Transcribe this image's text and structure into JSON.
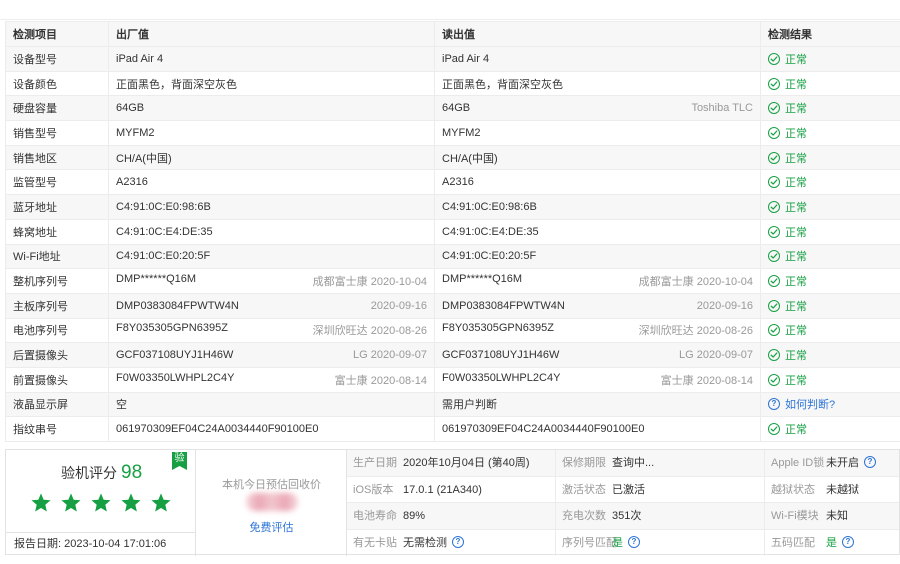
{
  "table": {
    "headers": [
      "检测项目",
      "出厂值",
      "读出值",
      "检测结果"
    ],
    "rows": [
      {
        "label": "设备型号",
        "factory": "iPad Air 4",
        "factory_note": "",
        "read": "iPad Air 4",
        "read_note": "",
        "result": "正常",
        "status": "ok"
      },
      {
        "label": "设备颜色",
        "factory": "正面黑色，背面深空灰色",
        "factory_note": "",
        "read": "正面黑色，背面深空灰色",
        "read_note": "",
        "result": "正常",
        "status": "ok"
      },
      {
        "label": "硬盘容量",
        "factory": "64GB",
        "factory_note": "",
        "read": "64GB",
        "read_note": "Toshiba TLC",
        "result": "正常",
        "status": "ok"
      },
      {
        "label": "销售型号",
        "factory": "MYFM2",
        "factory_note": "",
        "read": "MYFM2",
        "read_note": "",
        "result": "正常",
        "status": "ok"
      },
      {
        "label": "销售地区",
        "factory": "CH/A(中国)",
        "factory_note": "",
        "read": "CH/A(中国)",
        "read_note": "",
        "result": "正常",
        "status": "ok"
      },
      {
        "label": "监管型号",
        "factory": "A2316",
        "factory_note": "",
        "read": "A2316",
        "read_note": "",
        "result": "正常",
        "status": "ok"
      },
      {
        "label": "蓝牙地址",
        "factory": "C4:91:0C:E0:98:6B",
        "factory_note": "",
        "read": "C4:91:0C:E0:98:6B",
        "read_note": "",
        "result": "正常",
        "status": "ok"
      },
      {
        "label": "蜂窝地址",
        "factory": "C4:91:0C:E4:DE:35",
        "factory_note": "",
        "read": "C4:91:0C:E4:DE:35",
        "read_note": "",
        "result": "正常",
        "status": "ok"
      },
      {
        "label": "Wi-Fi地址",
        "factory": "C4:91:0C:E0:20:5F",
        "factory_note": "",
        "read": "C4:91:0C:E0:20:5F",
        "read_note": "",
        "result": "正常",
        "status": "ok"
      },
      {
        "label": "整机序列号",
        "factory": "DMP******Q16M",
        "factory_note": "成都富士康 2020-10-04",
        "read": "DMP******Q16M",
        "read_note": "成都富士康 2020-10-04",
        "result": "正常",
        "status": "ok"
      },
      {
        "label": "主板序列号",
        "factory": "DMP0383084FPWTW4N",
        "factory_note": "2020-09-16",
        "read": "DMP0383084FPWTW4N",
        "read_note": "2020-09-16",
        "result": "正常",
        "status": "ok"
      },
      {
        "label": "电池序列号",
        "factory": "F8Y035305GPN6395Z",
        "factory_note": "深圳欣旺达 2020-08-26",
        "read": "F8Y035305GPN6395Z",
        "read_note": "深圳欣旺达 2020-08-26",
        "result": "正常",
        "status": "ok"
      },
      {
        "label": "后置摄像头",
        "factory": "GCF037108UYJ1H46W",
        "factory_note": "LG 2020-09-07",
        "read": "GCF037108UYJ1H46W",
        "read_note": "LG 2020-09-07",
        "result": "正常",
        "status": "ok"
      },
      {
        "label": "前置摄像头",
        "factory": "F0W03350LWHPL2C4Y",
        "factory_note": "富士康 2020-08-14",
        "read": "F0W03350LWHPL2C4Y",
        "read_note": "富士康 2020-08-14",
        "result": "正常",
        "status": "ok"
      },
      {
        "label": "液晶显示屏",
        "factory": "空",
        "factory_note": "",
        "read": "需用户判断",
        "read_note": "",
        "result": "如何判断?",
        "status": "ask"
      },
      {
        "label": "指纹串号",
        "factory": "061970309EF04C24A0034440F90100E0",
        "factory_note": "",
        "read": "061970309EF04C24A0034440F90100E0",
        "read_note": "",
        "result": "正常",
        "status": "ok"
      }
    ]
  },
  "score": {
    "label": "验机评分",
    "value": "98",
    "badge": "验",
    "stars": 5,
    "report_date_label": "报告日期:",
    "report_date": "2023-10-04 17:01:06"
  },
  "estimate": {
    "label": "本机今日预估回收价",
    "link": "免费评估"
  },
  "info": [
    [
      {
        "label": "生产日期",
        "value": "2020年10月04日 (第40周)"
      },
      {
        "label": "保修期限",
        "value": "查询中..."
      },
      {
        "label": "Apple ID锁",
        "value": "未开启",
        "help": true
      }
    ],
    [
      {
        "label": "iOS版本",
        "value": "17.0.1 (21A340)"
      },
      {
        "label": "激活状态",
        "value": "已激活"
      },
      {
        "label": "越狱状态",
        "value": "未越狱"
      }
    ],
    [
      {
        "label": "电池寿命",
        "value": "89%"
      },
      {
        "label": "充电次数",
        "value": "351次"
      },
      {
        "label": "Wi-Fi模块",
        "value": "未知"
      }
    ],
    [
      {
        "label": "有无卡贴",
        "value": "无需检测",
        "help": true
      },
      {
        "label": "序列号匹配",
        "value": "是",
        "green": true,
        "help": true
      },
      {
        "label": "五码匹配",
        "value": "是",
        "green": true,
        "help": true
      }
    ]
  ],
  "colors": {
    "ok": "#17a043",
    "link": "#2d74d6",
    "muted": "#999999",
    "row_alt": "#f7f7f7"
  }
}
